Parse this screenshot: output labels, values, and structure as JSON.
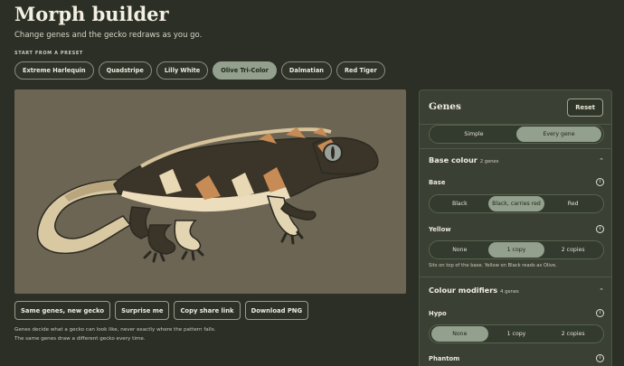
{
  "header": {
    "title": "Morph builder",
    "subtitle": "Change genes and the gecko redraws as you go."
  },
  "presets": {
    "label": "START FROM A PRESET",
    "items": [
      "Extreme Harlequin",
      "Quadstripe",
      "Lilly White",
      "Olive Tri-Color",
      "Dalmatian",
      "Red Tiger"
    ],
    "active": "Olive Tri-Color"
  },
  "actions": {
    "new_gecko": "Same genes, new gecko",
    "surprise": "Surprise me",
    "share": "Copy share link",
    "download": "Download PNG"
  },
  "note": "Genes decide what a gecko can look like, never exactly where the pattern falls. The same genes draw a different gecko every time.",
  "colors": {
    "canvas_bg": "#6c6553",
    "accent": "#93a08d",
    "page_bg": "#2b2f25",
    "panel_bg": "#3a4134"
  },
  "genes": {
    "title": "Genes",
    "reset": "Reset",
    "mode": {
      "simple": "Simple",
      "every": "Every gene",
      "selected": "Every gene"
    },
    "base_colour": {
      "title": "Base colour",
      "count": "2 genes",
      "base": {
        "label": "Base",
        "options": [
          "Black",
          "Black, carries red",
          "Red"
        ],
        "selected": "Black, carries red"
      },
      "yellow": {
        "label": "Yellow",
        "options": [
          "None",
          "1 copy",
          "2 copies"
        ],
        "selected": "1 copy",
        "hint": "Sits on top of the base. Yellow on Black reads as Olive."
      }
    },
    "colour_modifiers": {
      "title": "Colour modifiers",
      "count": "4 genes",
      "hypo": {
        "label": "Hypo",
        "options": [
          "None",
          "1 copy",
          "2 copies"
        ],
        "selected": "None"
      },
      "phantom": {
        "label": "Phantom"
      }
    }
  }
}
